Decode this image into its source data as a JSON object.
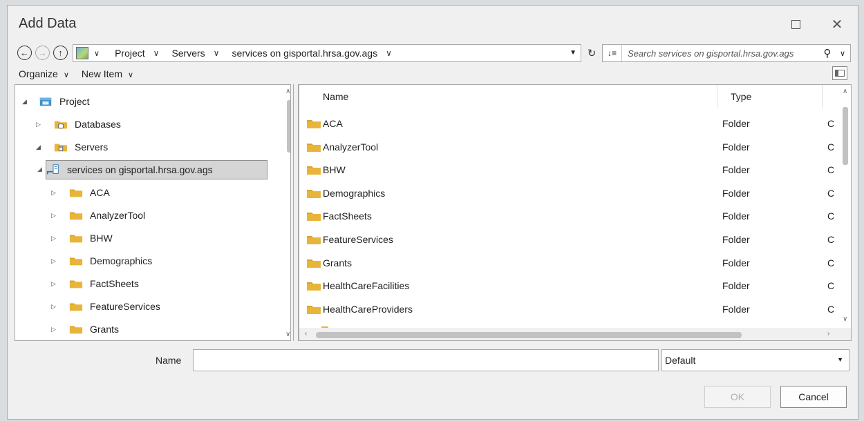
{
  "dialog": {
    "title": "Add Data"
  },
  "address": {
    "crumbs": [
      "Project",
      "Servers",
      "services on gisportal.hrsa.gov.ags"
    ]
  },
  "search": {
    "placeholder": "Search services on gisportal.hrsa.gov.ags"
  },
  "toolbar": {
    "organize": "Organize",
    "new_item": "New Item"
  },
  "tree": [
    {
      "label": "Project",
      "level": 0,
      "twisty": "◢",
      "icon": "project-icon"
    },
    {
      "label": "Databases",
      "level": 1,
      "twisty": "▷",
      "icon": "database-icon"
    },
    {
      "label": "Servers",
      "level": 1,
      "twisty": "◢",
      "icon": "server-icon"
    },
    {
      "label": "services on gisportal.hrsa.gov.ags",
      "level": 2,
      "twisty": "◢",
      "icon": "server-connection-icon",
      "selected": true
    },
    {
      "label": "ACA",
      "level": 3,
      "twisty": "▷",
      "icon": "folder-icon"
    },
    {
      "label": "AnalyzerTool",
      "level": 3,
      "twisty": "▷",
      "icon": "folder-icon"
    },
    {
      "label": "BHW",
      "level": 3,
      "twisty": "▷",
      "icon": "folder-icon"
    },
    {
      "label": "Demographics",
      "level": 3,
      "twisty": "▷",
      "icon": "folder-icon"
    },
    {
      "label": "FactSheets",
      "level": 3,
      "twisty": "▷",
      "icon": "folder-icon"
    },
    {
      "label": "FeatureServices",
      "level": 3,
      "twisty": "▷",
      "icon": "folder-icon"
    },
    {
      "label": "Grants",
      "level": 3,
      "twisty": "▷",
      "icon": "folder-icon"
    }
  ],
  "content": {
    "columns": {
      "name": "Name",
      "type": "Type"
    },
    "rows": [
      {
        "name": "ACA",
        "type": "Folder",
        "extra": "C"
      },
      {
        "name": "AnalyzerTool",
        "type": "Folder",
        "extra": "C"
      },
      {
        "name": "BHW",
        "type": "Folder",
        "extra": "C"
      },
      {
        "name": "Demographics",
        "type": "Folder",
        "extra": "C"
      },
      {
        "name": "FactSheets",
        "type": "Folder",
        "extra": "C"
      },
      {
        "name": "FeatureServices",
        "type": "Folder",
        "extra": "C"
      },
      {
        "name": "Grants",
        "type": "Folder",
        "extra": "C"
      },
      {
        "name": "HealthCareFacilities",
        "type": "Folder",
        "extra": "C"
      },
      {
        "name": "HealthCareProviders",
        "type": "Folder",
        "extra": "C"
      }
    ]
  },
  "footer": {
    "name_label": "Name",
    "name_value": "",
    "filter_value": "Default",
    "ok_label": "OK",
    "cancel_label": "Cancel"
  },
  "colors": {
    "folder": "#e8b53a",
    "folder_tab": "#d9a326",
    "selected_row": "#d5d5d5",
    "dialog_bg": "#f0f0f0",
    "disabled_text": "#b0b0b0"
  }
}
